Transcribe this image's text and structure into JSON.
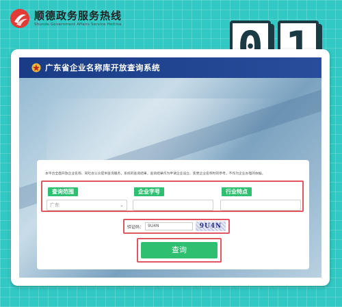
{
  "brand": {
    "name_cn": "顺德政务服务热线",
    "name_en": "Shunde Government Affairs Service Hotline",
    "logo_icon": "brand-logo-icon",
    "logo_color": "#e23b36"
  },
  "badge": {
    "digits": [
      "0",
      "1"
    ]
  },
  "app": {
    "title": "广东省企业名称库开放查询系统",
    "header_color": "#1a3c86"
  },
  "form": {
    "note": "本平台全面开放企业名称、同社会公众提供查询服务，系统的查询结果，查询结果作为申请企业设立、变更企业名称时的参考，不作为企业办理的依据。",
    "fields": [
      {
        "label": "查询范围",
        "value": "广东"
      },
      {
        "label": "企业字号",
        "value": ""
      },
      {
        "label": "行业特点",
        "value": ""
      }
    ],
    "captcha": {
      "label": "验证码：",
      "value": "9U4N",
      "image_text": "9U4N"
    },
    "submit_label": "查询",
    "accent_color": "#2fbf71",
    "highlight_color": "#e0555f"
  }
}
